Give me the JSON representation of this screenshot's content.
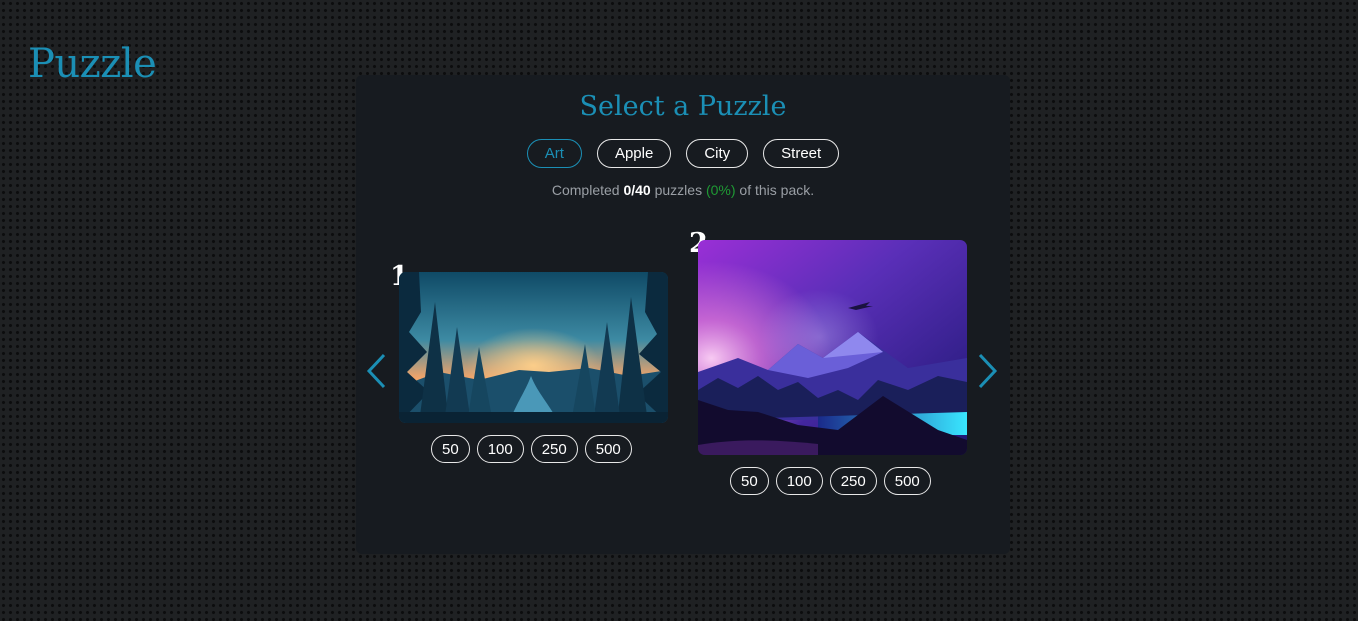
{
  "site": {
    "title": "Puzzle"
  },
  "panel": {
    "title": "Select a Puzzle",
    "packs": [
      {
        "label": "Art",
        "active": true
      },
      {
        "label": "Apple",
        "active": false
      },
      {
        "label": "City",
        "active": false
      },
      {
        "label": "Street",
        "active": false
      }
    ],
    "progress": {
      "prefix": "Completed",
      "count": "0/40",
      "middle": "puzzles",
      "percent": "(0%)",
      "suffix": "of this pack."
    },
    "carousel": {
      "prev_icon": "chevron-left-icon",
      "next_icon": "chevron-right-icon",
      "cards": [
        {
          "number": "1",
          "image": "forest-sunset-river-image",
          "sizes": [
            "50",
            "100",
            "250",
            "500"
          ]
        },
        {
          "number": "2",
          "image": "purple-mountains-lake-image",
          "sizes": [
            "50",
            "100",
            "250",
            "500"
          ]
        }
      ]
    }
  },
  "colors": {
    "accent": "#1b8fb5",
    "panel_bg": "#171b20",
    "page_bg": "#1f2123",
    "progress_green": "#1f9a34",
    "muted_text": "#9a9fa5"
  }
}
